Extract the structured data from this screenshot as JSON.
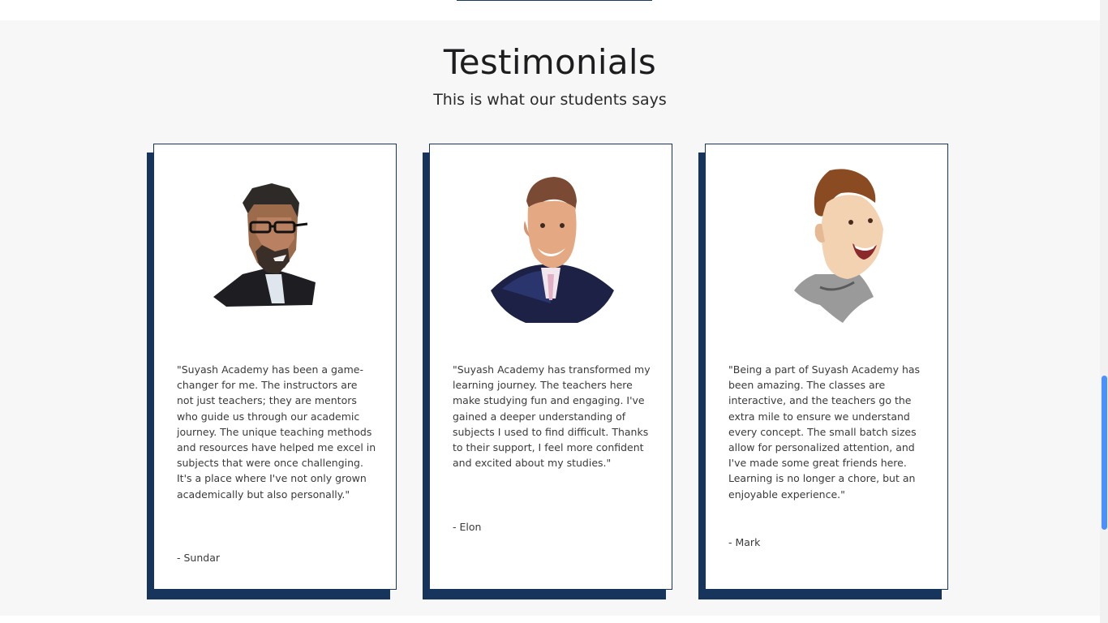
{
  "section": {
    "title": "Testimonials",
    "subtitle": "This is what our students says"
  },
  "testimonials": [
    {
      "quote": "\"Suyash Academy has been a game-changer for me. The instructors are not just teachers; they are mentors who guide us through our academic journey. The unique teaching methods and resources have helped me excel in subjects that were once challenging. It's a place where I've not only grown academically but also personally.\"",
      "author": "- Sundar",
      "avatar_icon": "student-portrait-sundar"
    },
    {
      "quote": "\"Suyash Academy has transformed my learning journey. The teachers here make studying fun and engaging. I've gained a deeper understanding of subjects I used to find difficult. Thanks to their support, I feel more confident and excited about my studies.\"",
      "author": "- Elon",
      "avatar_icon": "student-portrait-elon"
    },
    {
      "quote": "\"Being a part of Suyash Academy has been amazing. The classes are interactive, and the teachers go the extra mile to ensure we understand every concept. The small batch sizes allow for personalized attention, and I've made some great friends here. Learning is no longer a chore, but an enjoyable experience.\"",
      "author": "- Mark",
      "avatar_icon": "student-portrait-mark"
    }
  ],
  "colors": {
    "accent": "#17355c",
    "section_bg": "#f7f7f8",
    "card_bg": "#ffffff",
    "scroll_thumb": "#4a90ff"
  }
}
